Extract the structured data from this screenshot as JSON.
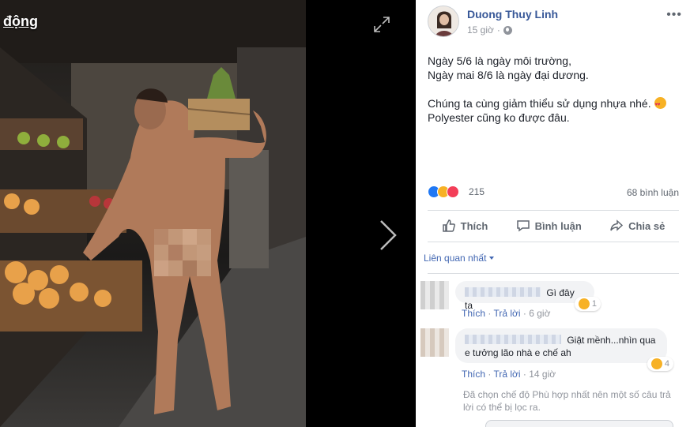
{
  "viewer": {
    "overlay_text": "động",
    "expand_icon": "expand-icon",
    "next_icon": "chevron-right-icon"
  },
  "post": {
    "author": "Duong Thuy Linh",
    "time": "15 giờ",
    "privacy_icon": "globe-icon",
    "more_icon": "more-icon",
    "text_lines": [
      "Ngày 5/6 là ngày môi trường,",
      "Ngày mai 8/6 là ngày đại dương.",
      "Chúng ta cùng giảm thiểu sử dụng nhựa nhé.",
      "Polyester cũng ko được đâu."
    ],
    "reaction_count": "215",
    "comment_count": "68 bình luận",
    "actions": {
      "like": "Thích",
      "comment": "Bình luận",
      "share": "Chia sẻ"
    },
    "sort_label": "Liên quan nhất"
  },
  "comments": [
    {
      "text": "Gì đây ta",
      "reactions": "1",
      "like": "Thích",
      "reply": "Trả lời",
      "time": "6 giờ"
    },
    {
      "text_line1": "Giật mềnh...nhìn qua",
      "text_line2": "e tưởng lão nhà e chế ah",
      "reactions": "4",
      "like": "Thích",
      "reply": "Trả lời",
      "time": "14 giờ"
    }
  ],
  "filter_note": "Đã chọn chế độ Phù hợp nhất nên một số câu trả lời có thể bị lọc ra.",
  "colors": {
    "link": "#385898",
    "accent": "#4267b2",
    "muted": "#90949c",
    "bubble": "#f2f3f5"
  }
}
